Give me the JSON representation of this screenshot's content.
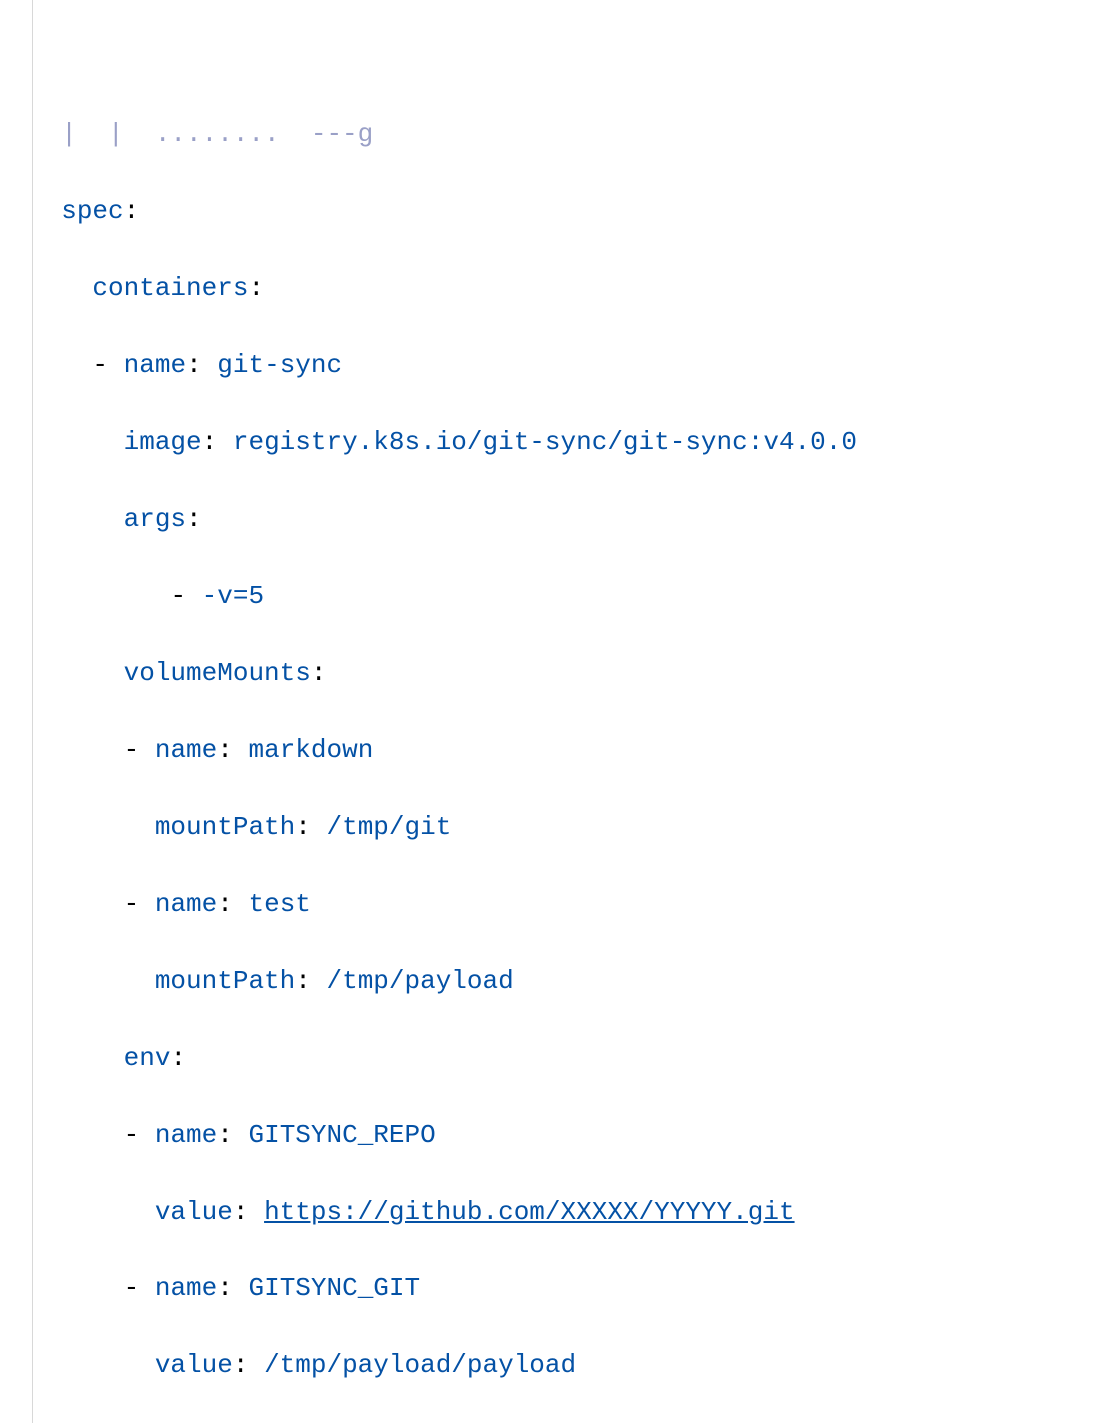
{
  "yaml": {
    "faded_top": "  |  |  ........  ---g",
    "spec_key": "spec",
    "containers_key": "containers",
    "name_key": "name",
    "image_key": "image",
    "args_key": "args",
    "volumeMounts_key": "volumeMounts",
    "mountPath_key": "mountPath",
    "env_key": "env",
    "value_key": "value",
    "colon": ":",
    "dash": "-",
    "container_name": "git-sync",
    "image_val": "registry.k8s.io/git-sync/git-sync:v4.0.0",
    "arg0": "-v=5",
    "vm0_name": "markdown",
    "vm0_path": "/tmp/git",
    "vm1_name": "test",
    "vm1_path": "/tmp/payload",
    "env0_name": "GITSYNC_REPO",
    "env0_value": "https://github.com/XXXXX/YYYYY.git",
    "env1_name": "GITSYNC_GIT",
    "env1_value": "/tmp/payload/payload"
  }
}
